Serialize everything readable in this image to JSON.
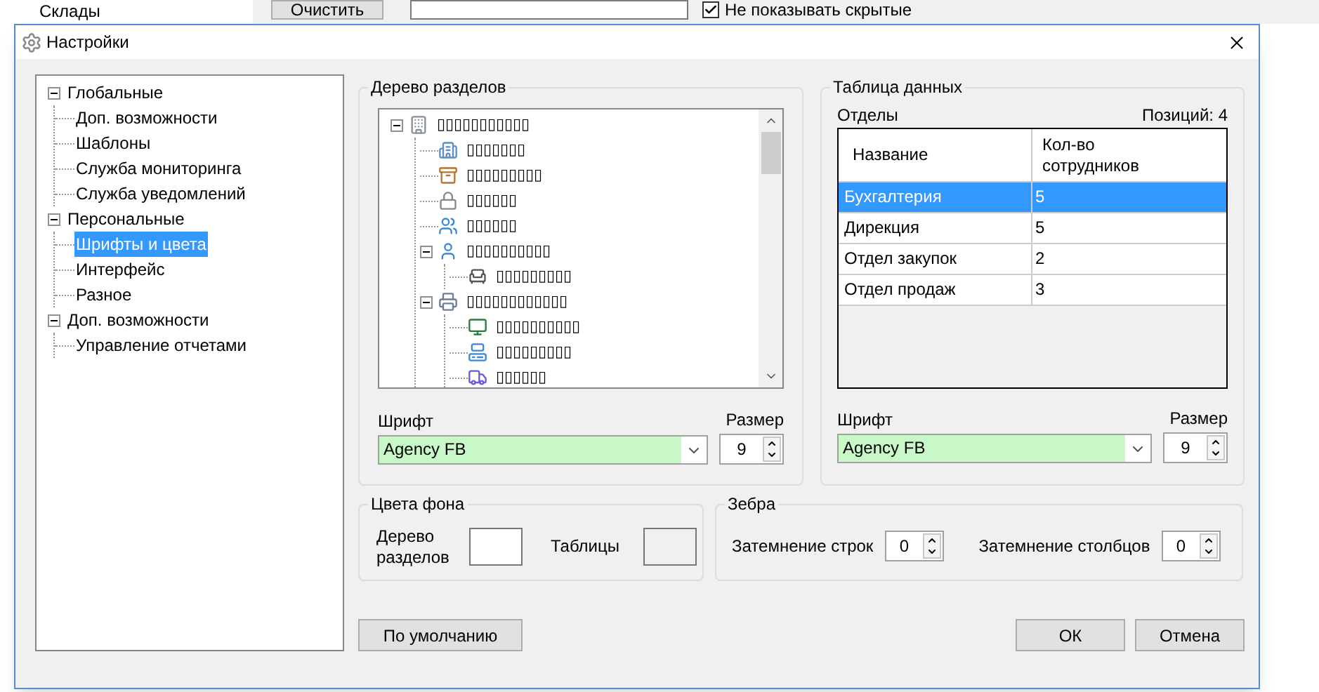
{
  "background": {
    "tree_item": "Склады",
    "clear_button": "Очистить",
    "hide_checkbox": {
      "label": "Не показывать скрытые",
      "checked": true
    }
  },
  "window": {
    "title": "Настройки"
  },
  "sidebar": {
    "items": [
      {
        "label": "Глобальные",
        "expanded": true,
        "selected": false,
        "children": [
          {
            "label": "Доп. возможности",
            "selected": false
          },
          {
            "label": "Шаблоны",
            "selected": false
          },
          {
            "label": "Служба мониторинга",
            "selected": false
          },
          {
            "label": "Служба уведомлений",
            "selected": false
          }
        ]
      },
      {
        "label": "Персональные",
        "expanded": true,
        "selected": false,
        "children": [
          {
            "label": "Шрифты и цвета",
            "selected": true
          },
          {
            "label": "Интерфейс",
            "selected": false
          },
          {
            "label": "Разное",
            "selected": false
          }
        ]
      },
      {
        "label": "Доп. возможности",
        "expanded": true,
        "selected": false,
        "children": [
          {
            "label": "Управление отчетами",
            "selected": false
          }
        ]
      }
    ]
  },
  "section_tree": {
    "title": "Дерево разделов",
    "nodes": [
      {
        "label": "▯▯▯▯▯▯▯▯▯▯▯",
        "expanded": true,
        "children": [
          {
            "label": "▯▯▯▯▯▯▯"
          },
          {
            "label": "▯▯▯▯▯▯▯▯▯"
          },
          {
            "label": "▯▯▯▯▯▯"
          },
          {
            "label": "▯▯▯▯▯▯"
          },
          {
            "label": "▯▯▯▯▯▯▯▯▯▯",
            "expanded": true,
            "children": [
              {
                "label": "▯▯▯▯▯▯▯▯▯"
              }
            ]
          },
          {
            "label": "▯▯▯▯▯▯▯▯▯▯▯▯",
            "expanded": true,
            "children": [
              {
                "label": "▯▯▯▯▯▯▯▯▯▯"
              },
              {
                "label": "▯▯▯▯▯▯▯▯▯"
              },
              {
                "label": "▯▯▯▯▯▯"
              }
            ]
          }
        ]
      }
    ],
    "font_label": "Шрифт",
    "font": "Agency FB",
    "size_label": "Размер",
    "size": "9"
  },
  "data_table": {
    "title": "Таблица данных",
    "caption": "Отделы",
    "count": "Позиций: 4",
    "columns": [
      "Название",
      "Кол-во сотрудников"
    ],
    "rows": [
      {
        "cells": [
          "Бухгалтерия",
          "5"
        ],
        "selected": true
      },
      {
        "cells": [
          "Дирекция",
          "5"
        ],
        "selected": false
      },
      {
        "cells": [
          "Отдел закупок",
          "2"
        ],
        "selected": false
      },
      {
        "cells": [
          "Отдел продаж",
          "3"
        ],
        "selected": false
      }
    ],
    "font_label": "Шрифт",
    "font": "Agency FB",
    "size_label": "Размер",
    "size": "9"
  },
  "background_colors": {
    "title": "Цвета фона",
    "items": [
      {
        "label": "Дерево разделов",
        "color": "#ffffff"
      },
      {
        "label": "Таблицы",
        "color": "#f0f0f0"
      }
    ]
  },
  "zebra": {
    "title": "Зебра",
    "items": [
      {
        "label": "Затемнение строк",
        "value": "0"
      },
      {
        "label": "Затемнение столбцов",
        "value": "0"
      }
    ]
  },
  "buttons": {
    "defaults": "По умолчанию",
    "ok": "ОК",
    "cancel": "Отмена"
  }
}
